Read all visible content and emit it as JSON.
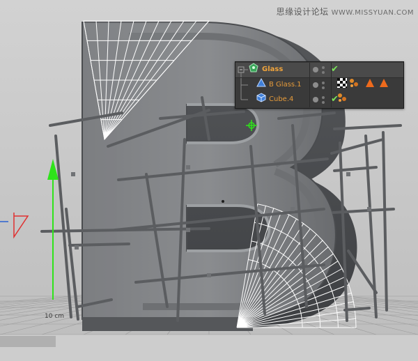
{
  "watermark": {
    "site_name": "思缘设计论坛",
    "url": "WWW.MISSYUAN.COM"
  },
  "viewport": {
    "grid_scale_label": "10 cm"
  },
  "object_manager": {
    "objects": [
      {
        "name": "Glass",
        "level": 0,
        "icon": "symmetry-icon",
        "enabled": true,
        "tags": []
      },
      {
        "name": "B Glass.1",
        "level": 1,
        "icon": "extrude-icon",
        "enabled": false,
        "tags": [
          "checker-material-tag",
          "multi-dot-tag",
          "warning-triangle-tag",
          "warning-triangle-tag"
        ]
      },
      {
        "name": "Cube.4",
        "level": 1,
        "icon": "cube-icon",
        "enabled": true,
        "tags": [
          "multi-dot-tag"
        ]
      }
    ]
  },
  "colors": {
    "axis_y": "#2ee31a",
    "axis_x": "#e03030",
    "axis_z": "#2a60d0",
    "object_name": "#e59b3a",
    "manager_bg": "#3a3a3a",
    "selected_row": "#4a4a4a",
    "enabled_check": "#7be35a",
    "tag_warning": "#ee6a1c"
  }
}
